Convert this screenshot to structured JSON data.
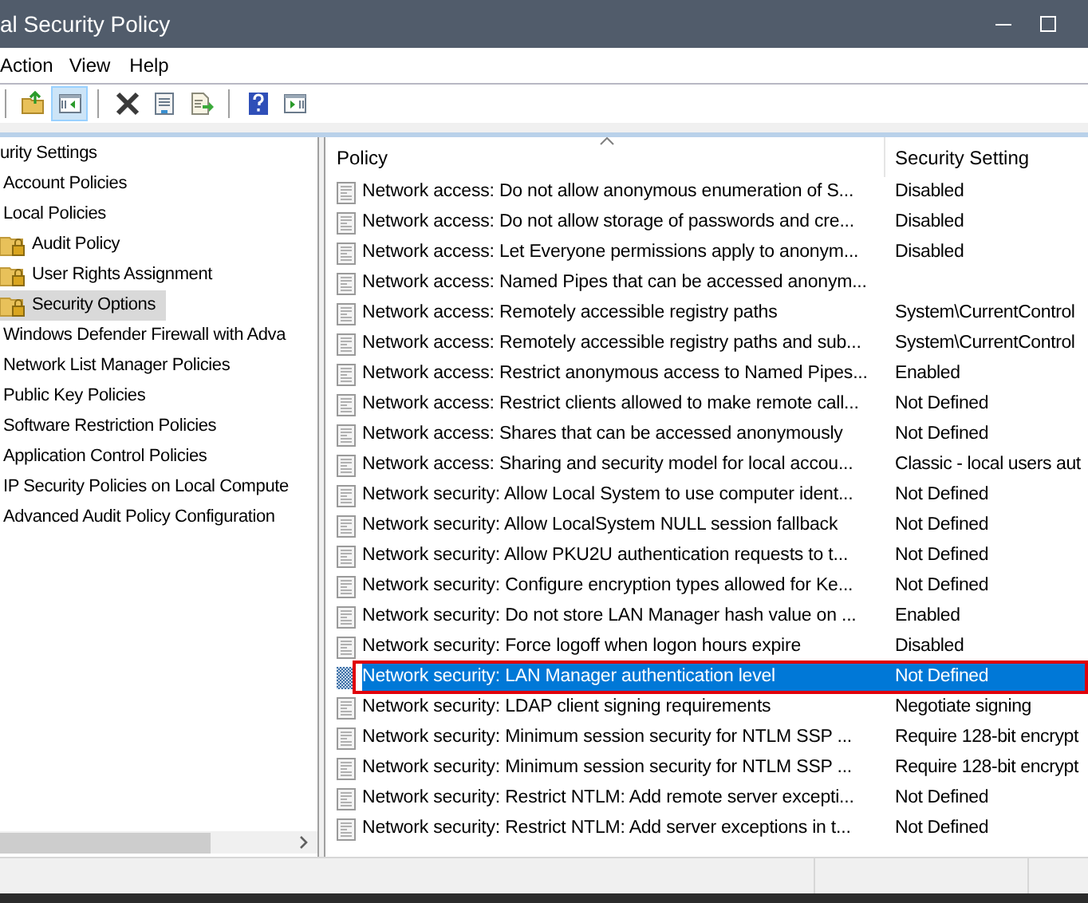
{
  "window": {
    "title": "al Security Policy"
  },
  "menu": [
    "Action",
    "View",
    "Help"
  ],
  "toolbar": [
    {
      "kind": "separator"
    },
    {
      "kind": "up-folder",
      "pressed": false
    },
    {
      "kind": "tree-pane",
      "pressed": true
    },
    {
      "kind": "separator"
    },
    {
      "kind": "delete",
      "pressed": false
    },
    {
      "kind": "properties",
      "pressed": false
    },
    {
      "kind": "export",
      "pressed": false
    },
    {
      "kind": "separator"
    },
    {
      "kind": "help",
      "pressed": false
    },
    {
      "kind": "action-pane",
      "pressed": false
    }
  ],
  "tree": [
    {
      "label": "urity Settings",
      "selected": false,
      "children": [
        {
          "label": "Account Policies",
          "selected": false
        },
        {
          "label": "Local Policies",
          "selected": false,
          "children": [
            {
              "label": "Audit Policy",
              "selected": false
            },
            {
              "label": "User Rights Assignment",
              "selected": false
            },
            {
              "label": "Security Options",
              "selected": true
            }
          ]
        },
        {
          "label": "Windows Defender Firewall with Adva",
          "selected": false
        },
        {
          "label": "Network List Manager Policies",
          "selected": false
        },
        {
          "label": "Public Key Policies",
          "selected": false
        },
        {
          "label": "Software Restriction Policies",
          "selected": false
        },
        {
          "label": "Application Control Policies",
          "selected": false
        },
        {
          "label": "IP Security Policies on Local Compute",
          "selected": false
        },
        {
          "label": "Advanced Audit Policy Configuration",
          "selected": false
        }
      ]
    }
  ],
  "table": {
    "columns": [
      "Policy",
      "Security Setting"
    ],
    "rows": [
      {
        "policy": "Network access: Do not allow anonymous enumeration of S...",
        "setting": "Disabled",
        "selected": false,
        "outlined": false
      },
      {
        "policy": "Network access: Do not allow storage of passwords and cre...",
        "setting": "Disabled",
        "selected": false,
        "outlined": false
      },
      {
        "policy": "Network access: Let Everyone permissions apply to anonym...",
        "setting": "Disabled",
        "selected": false,
        "outlined": false
      },
      {
        "policy": "Network access: Named Pipes that can be accessed anonym...",
        "selected": false,
        "outlined": false
      },
      {
        "policy": "Network access: Remotely accessible registry paths",
        "setting": "System\\CurrentControl",
        "selected": false,
        "outlined": false
      },
      {
        "policy": "Network access: Remotely accessible registry paths and sub...",
        "setting": "System\\CurrentControl",
        "selected": false,
        "outlined": false
      },
      {
        "policy": "Network access: Restrict anonymous access to Named Pipes...",
        "setting": "Enabled",
        "selected": false,
        "outlined": false
      },
      {
        "policy": "Network access: Restrict clients allowed to make remote call...",
        "setting": "Not Defined",
        "selected": false,
        "outlined": false
      },
      {
        "policy": "Network access: Shares that can be accessed anonymously",
        "setting": "Not Defined",
        "selected": false,
        "outlined": false
      },
      {
        "policy": "Network access: Sharing and security model for local accou...",
        "setting": "Classic - local users aut",
        "selected": false,
        "outlined": false
      },
      {
        "policy": "Network security: Allow Local System to use computer ident...",
        "setting": "Not Defined",
        "selected": false,
        "outlined": false
      },
      {
        "policy": "Network security: Allow LocalSystem NULL session fallback",
        "setting": "Not Defined",
        "selected": false,
        "outlined": false
      },
      {
        "policy": "Network security: Allow PKU2U authentication requests to t...",
        "setting": "Not Defined",
        "selected": false,
        "outlined": false
      },
      {
        "policy": "Network security: Configure encryption types allowed for Ke...",
        "setting": "Not Defined",
        "selected": false,
        "outlined": false
      },
      {
        "policy": "Network security: Do not store LAN Manager hash value on ...",
        "setting": "Enabled",
        "selected": false,
        "outlined": false
      },
      {
        "policy": "Network security: Force logoff when logon hours expire",
        "setting": "Disabled",
        "selected": false,
        "outlined": false
      },
      {
        "policy": "Network security: LAN Manager authentication level",
        "setting": "Not Defined",
        "selected": true,
        "outlined": true
      },
      {
        "policy": "Network security: LDAP client signing requirements",
        "setting": "Negotiate signing",
        "selected": false,
        "outlined": false
      },
      {
        "policy": "Network security: Minimum session security for NTLM SSP ...",
        "setting": "Require 128-bit encrypt",
        "selected": false,
        "outlined": false
      },
      {
        "policy": "Network security: Minimum session security for NTLM SSP ...",
        "setting": "Require 128-bit encrypt",
        "selected": false,
        "outlined": false
      },
      {
        "policy": "Network security: Restrict NTLM: Add remote server excepti...",
        "setting": "Not Defined",
        "selected": false,
        "outlined": false
      },
      {
        "policy": "Network security: Restrict NTLM: Add server exceptions in t...",
        "setting": "Not Defined",
        "selected": false,
        "outlined": false
      }
    ]
  }
}
